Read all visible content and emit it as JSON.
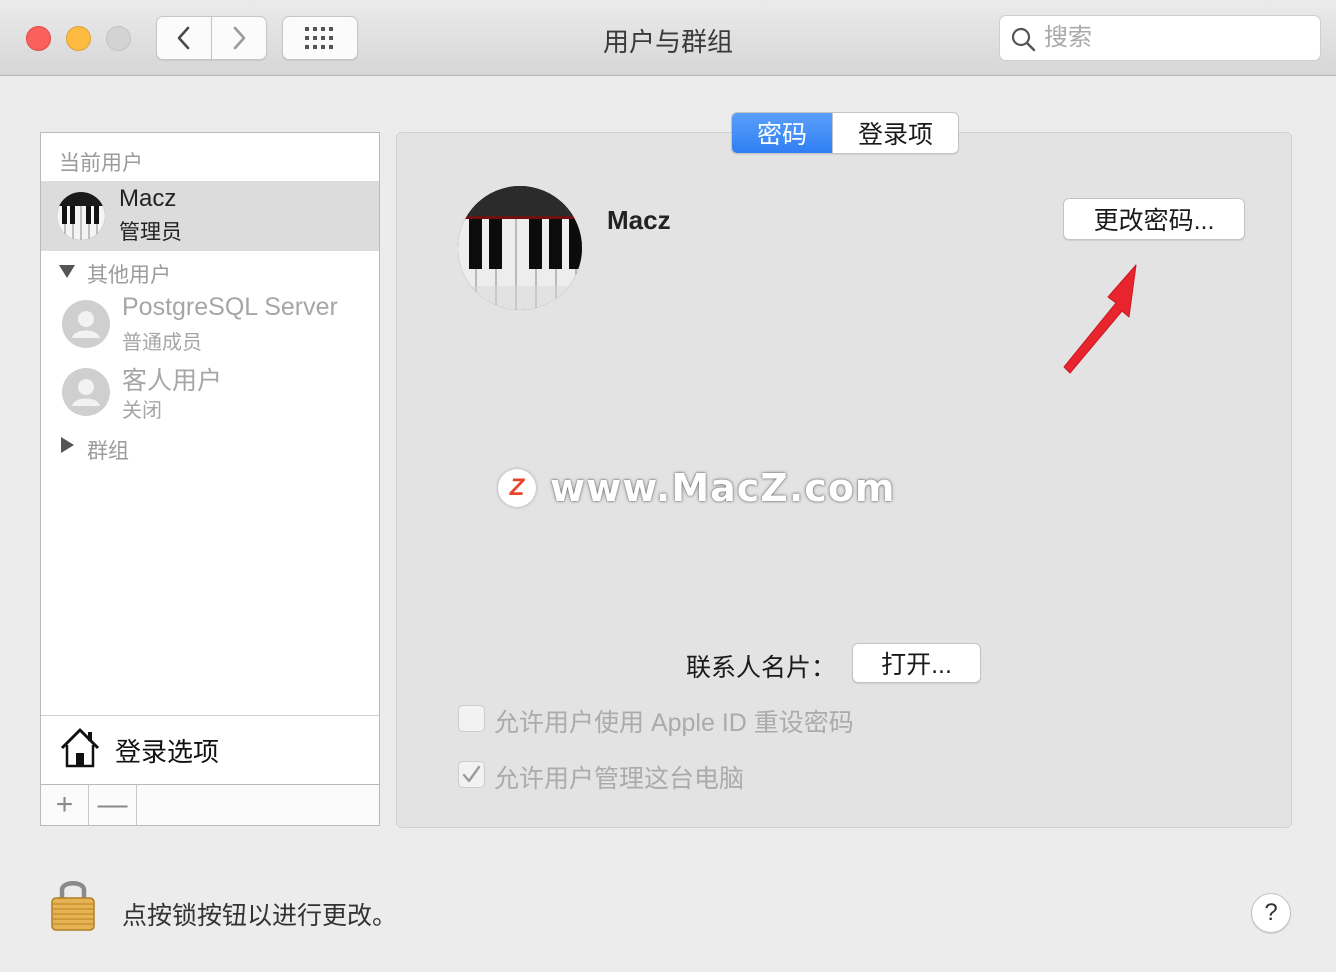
{
  "window": {
    "title": "用户与群组"
  },
  "search": {
    "placeholder": "搜索"
  },
  "sidebar": {
    "current_header": "当前用户",
    "current_user": {
      "name": "Macz",
      "role": "管理员"
    },
    "other_header": "其他用户",
    "other_users": [
      {
        "name": "PostgreSQL Server",
        "role": "普通成员"
      },
      {
        "name": "客人用户",
        "role": "关闭"
      }
    ],
    "groups_header": "群组",
    "login_options": "登录选项",
    "add_label": "+",
    "remove_label": "—"
  },
  "tabs": [
    {
      "label": "密码",
      "active": true
    },
    {
      "label": "登录项",
      "active": false
    }
  ],
  "main": {
    "user_name": "Macz",
    "change_password": "更改密码...",
    "contact_label": "联系人名片：",
    "open_button": "打开...",
    "checkbox_apple_id": {
      "label": "允许用户使用 Apple ID 重设密码",
      "checked": false
    },
    "checkbox_admin": {
      "label": "允许用户管理这台电脑",
      "checked": true
    }
  },
  "watermark": {
    "logo": "Z",
    "text": "www.MacZ.com"
  },
  "footer": {
    "lock_text": "点按锁按钮以进行更改。",
    "help": "?"
  },
  "colors": {
    "accent": "#2f7ef3",
    "arrow": "#e8252f"
  }
}
